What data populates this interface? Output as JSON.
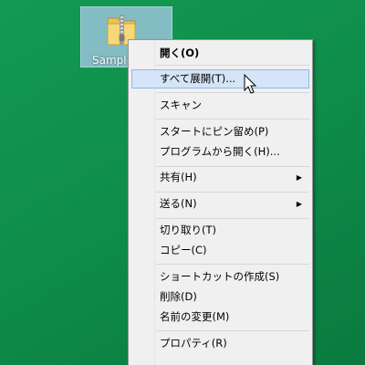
{
  "desktop": {
    "icon_label": "Sampl",
    "icon_name": "zip-folder-icon"
  },
  "context_menu": {
    "items": [
      {
        "label": "開く(O)"
      },
      {
        "label": "すべて展開(T)..."
      },
      {
        "label": "スキャン"
      },
      {
        "label": "スタートにピン留め(P)"
      },
      {
        "label": "プログラムから開く(H)..."
      },
      {
        "label": "共有(H)",
        "submenu": "▶"
      },
      {
        "label": "送る(N)",
        "submenu": "▶"
      },
      {
        "label": "切り取り(T)"
      },
      {
        "label": "コピー(C)"
      },
      {
        "label": "ショートカットの作成(S)"
      },
      {
        "label": "削除(D)"
      },
      {
        "label": "名前の変更(M)"
      },
      {
        "label": "プロパティ(R)"
      }
    ]
  },
  "colors": {
    "desktop_bg": "#0f8e4b",
    "highlight_bg": "#d5e5f7",
    "highlight_border": "#8fb8e8"
  }
}
